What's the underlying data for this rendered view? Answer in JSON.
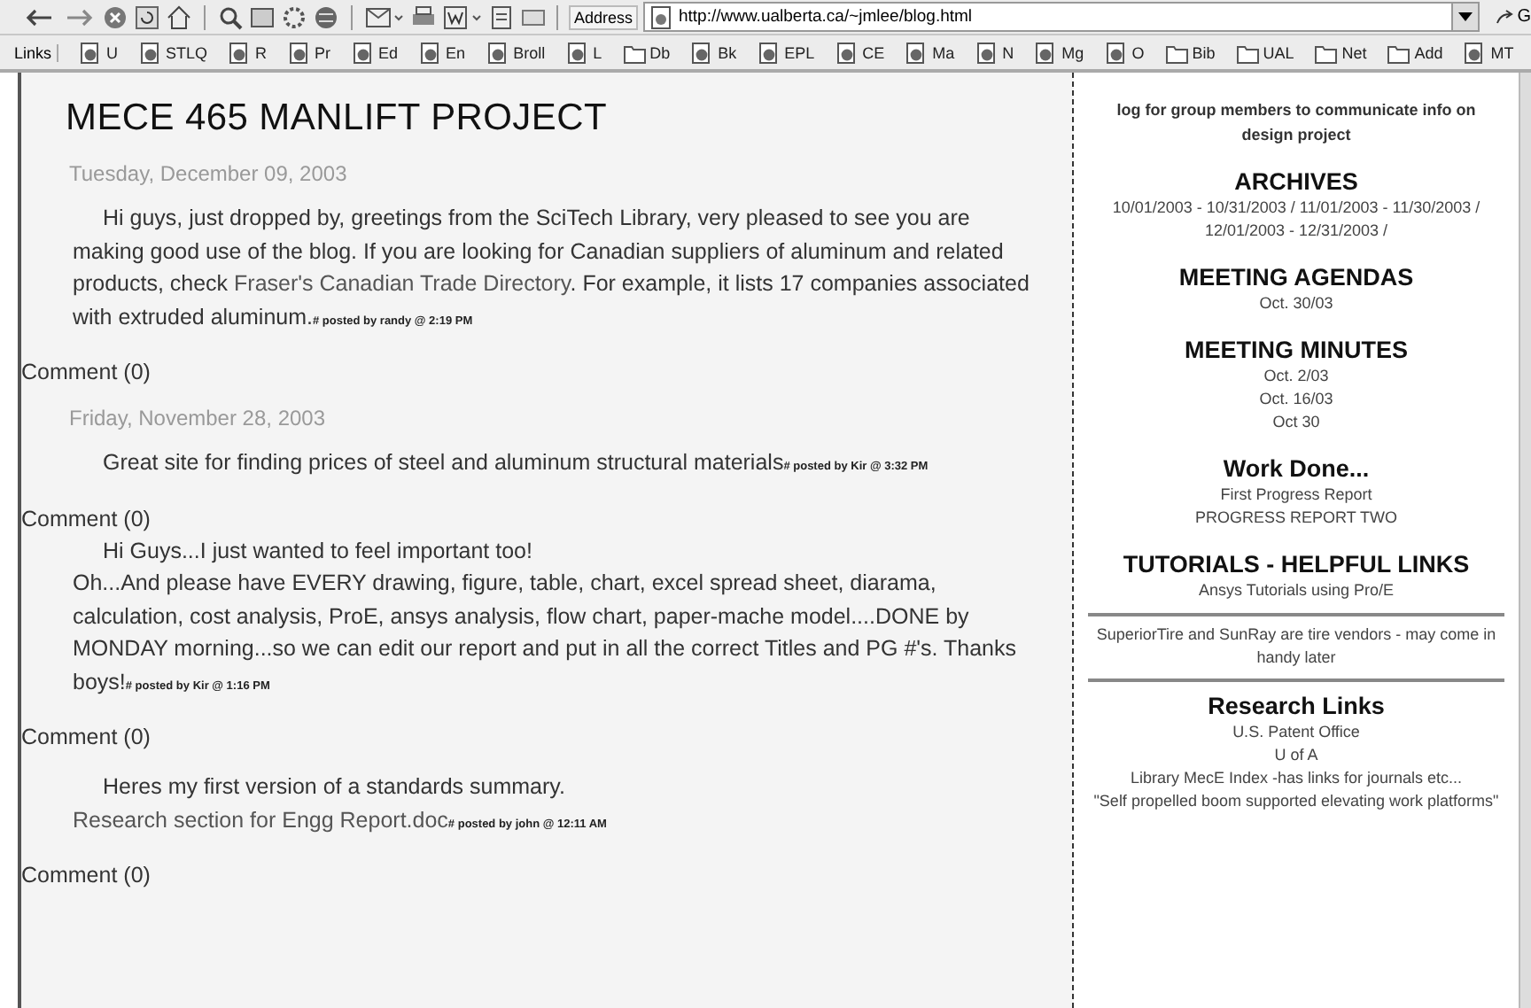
{
  "browser": {
    "address_label": "Address",
    "url": "http://www.ualberta.ca/~jmlee/blog.html",
    "go_label": "G",
    "links_label": "Links",
    "links": [
      {
        "label": "U",
        "kind": "page"
      },
      {
        "label": "STLQ",
        "kind": "page"
      },
      {
        "label": "R",
        "kind": "page"
      },
      {
        "label": "Pr",
        "kind": "page"
      },
      {
        "label": "Ed",
        "kind": "page"
      },
      {
        "label": "En",
        "kind": "page"
      },
      {
        "label": "Broll",
        "kind": "page"
      },
      {
        "label": "L",
        "kind": "page"
      },
      {
        "label": "Db",
        "kind": "folder"
      },
      {
        "label": "Bk",
        "kind": "page"
      },
      {
        "label": "EPL",
        "kind": "page"
      },
      {
        "label": "CE",
        "kind": "page"
      },
      {
        "label": "Ma",
        "kind": "page"
      },
      {
        "label": "N",
        "kind": "page"
      },
      {
        "label": "Mg",
        "kind": "page"
      },
      {
        "label": "O",
        "kind": "page"
      },
      {
        "label": "Bib",
        "kind": "folder"
      },
      {
        "label": "UAL",
        "kind": "folder"
      },
      {
        "label": "Net",
        "kind": "folder"
      },
      {
        "label": "Add",
        "kind": "folder"
      },
      {
        "label": "MT",
        "kind": "page"
      }
    ]
  },
  "blog": {
    "title": "MECE 465 MANLIFT PROJECT",
    "posts": [
      {
        "date": "Tuesday, December 09, 2003",
        "paragraphs": [
          [
            {
              "text": "Hi guys, just dropped by, greetings from the SciTech Library, very pleased to see you are making good use of the blog. If you are looking for Canadian suppliers of aluminum and related products, check ",
              "link": false
            },
            {
              "text": "Fraser's Canadian Trade Directory",
              "link": true
            },
            {
              "text": ". For example, it lists 17 companies associated with extruded aluminum.",
              "link": false
            }
          ]
        ],
        "posted_by": "# posted by randy @ 2:19 PM",
        "comments": "Comment (0)"
      },
      {
        "date": "Friday, November 28, 2003",
        "paragraphs": [
          [
            {
              "text": "Great site for finding prices of steel and aluminum structural materials",
              "link": false
            }
          ]
        ],
        "posted_by": "# posted by Kir @ 3:32 PM",
        "comments": "Comment (0)"
      },
      {
        "paragraphs": [
          [
            {
              "text": "Hi Guys...I just wanted to feel important too!",
              "link": false
            }
          ],
          [
            {
              "text": "Oh...And please have EVERY drawing, figure, table, chart, excel spread sheet, diarama, calculation, cost analysis, ProE, ansys analysis, flow chart, paper-mache model....DONE by MONDAY morning...so we can edit our report and put in all the correct Titles and PG #'s. Thanks boys!",
              "link": false
            }
          ]
        ],
        "posted_by": "# posted by Kir @ 1:16 PM",
        "comments": "Comment (0)"
      },
      {
        "paragraphs": [
          [
            {
              "text": "Heres my first version of a standards summary. ",
              "link": false
            },
            {
              "text": "Research section for Engg Report.doc",
              "link": true
            }
          ]
        ],
        "posted_by": "# posted by john @ 12:11 AM",
        "comments": "Comment (0)"
      }
    ]
  },
  "sidebar": {
    "description": "log for group members to communicate info on design project",
    "sections": [
      {
        "kind": "section",
        "title": "ARCHIVES",
        "items": [
          "10/01/2003 - 10/31/2003 / 11/01/2003 - 11/30/2003 / 12/01/2003 - 12/31/2003 /"
        ]
      },
      {
        "kind": "section",
        "title": "MEETING AGENDAS",
        "items": [
          "Oct. 30/03"
        ]
      },
      {
        "kind": "section",
        "title": "MEETING MINUTES",
        "items": [
          "Oct. 2/03",
          "Oct. 16/03",
          "Oct 30"
        ]
      },
      {
        "kind": "section",
        "title": "Work Done...",
        "items": [
          "First Progress Report",
          "PROGRESS REPORT TWO"
        ]
      },
      {
        "kind": "section",
        "title": "TUTORIALS - HELPFUL LINKS",
        "items": [
          "Ansys Tutorials using Pro/E"
        ]
      },
      {
        "kind": "note",
        "items": [
          "SuperiorTire and SunRay are tire vendors - may come in handy later"
        ]
      },
      {
        "kind": "section",
        "title": "Research Links",
        "items": [
          "U.S. Patent Office",
          "U of A",
          "Library MecE Index -has links for journals etc...",
          "\"Self propelled boom supported elevating work platforms\""
        ]
      }
    ]
  }
}
